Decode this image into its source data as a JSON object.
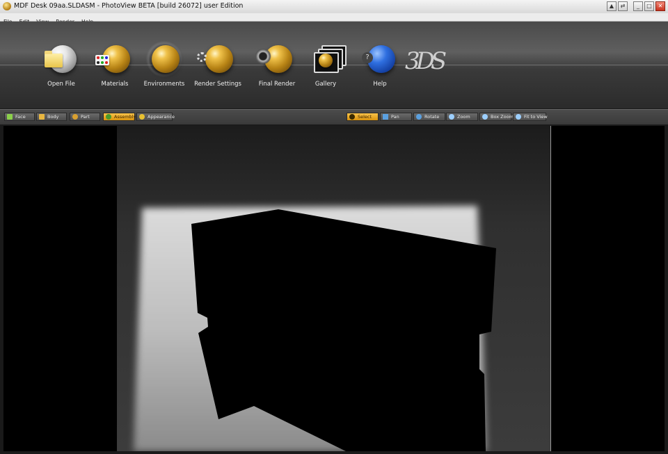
{
  "window": {
    "title": "MDF Desk 09aa.SLDASM - PhotoView BETA [build 26072] user Edition",
    "buttons": {
      "extra1": "▲",
      "extra2": "⇄",
      "minimize": "_",
      "maximize": "□",
      "close": "✕"
    }
  },
  "menu": [
    "File",
    "Edit",
    "View",
    "Render",
    "Help"
  ],
  "toolbar": {
    "items": [
      {
        "label": "Open File",
        "icon": "open-file-icon"
      },
      {
        "label": "Materials",
        "icon": "materials-icon"
      },
      {
        "label": "Environments",
        "icon": "environments-icon"
      },
      {
        "label": "Render Settings",
        "icon": "render-settings-icon"
      },
      {
        "label": "Final Render",
        "icon": "final-render-icon"
      },
      {
        "label": "Gallery",
        "icon": "gallery-icon"
      },
      {
        "label": "Help",
        "icon": "help-icon"
      }
    ],
    "brand_logo": "3DS"
  },
  "selection_filters": [
    {
      "label": "Face",
      "active": false
    },
    {
      "label": "Body",
      "active": false
    },
    {
      "label": "Part",
      "active": false
    },
    {
      "label": "Assembly",
      "active": true
    },
    {
      "label": "Appearance",
      "active": false
    }
  ],
  "view_tools": [
    {
      "label": "Select",
      "active": true
    },
    {
      "label": "Pan",
      "active": false
    },
    {
      "label": "Rotate",
      "active": false
    },
    {
      "label": "Zoom",
      "active": false
    },
    {
      "label": "Box Zoom",
      "active": false
    },
    {
      "label": "Fit to View",
      "active": false
    }
  ],
  "colors": {
    "accent": "#f0b030",
    "toolbar_bg": "#3a3a3a",
    "viewport_bg": "#000000"
  }
}
